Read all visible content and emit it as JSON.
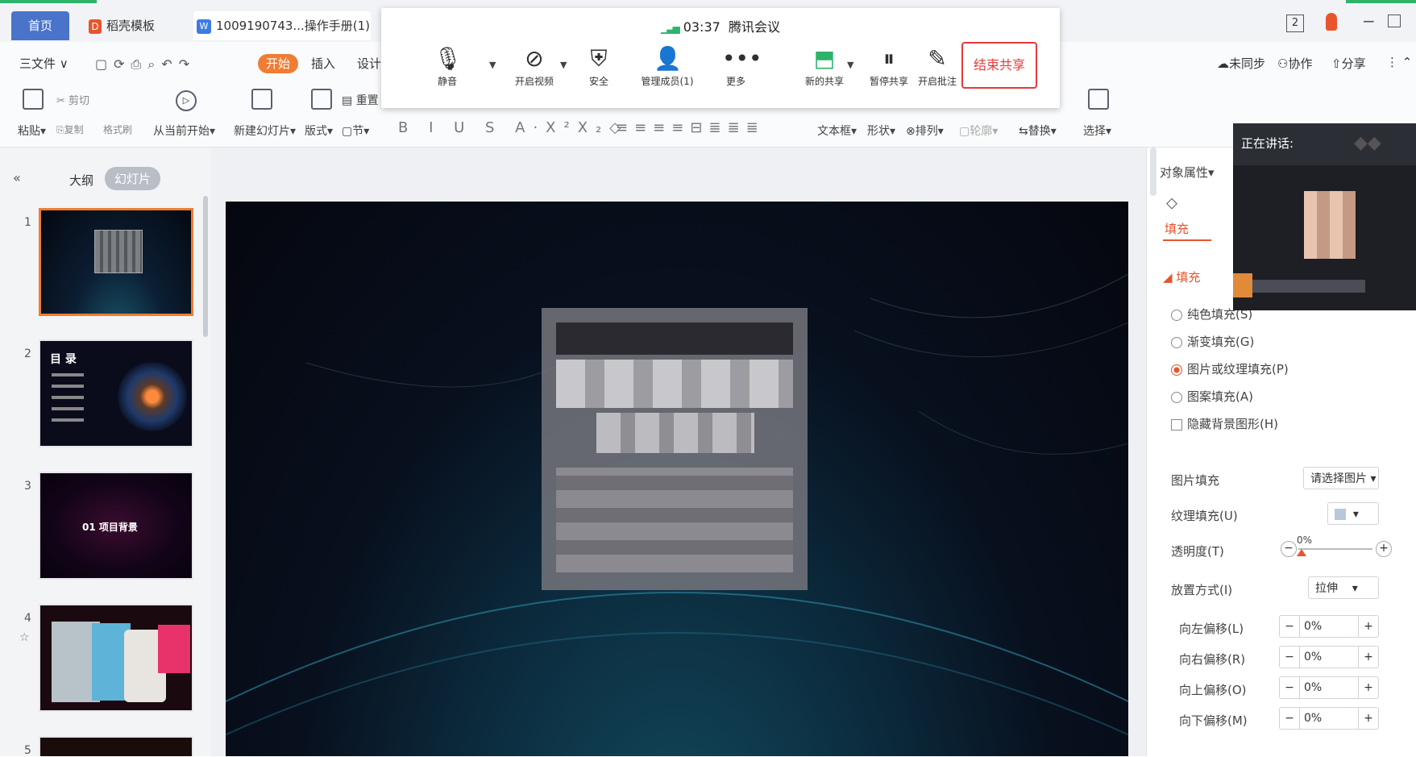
{
  "tabs": {
    "home": "首页",
    "daoke": "稻壳模板",
    "doc": "1009190743...操作手册(1)(1)"
  },
  "topright": {
    "badge": "2"
  },
  "menu": {
    "file": "三文件",
    "start": "开始",
    "insert": "插入",
    "design": "设计"
  },
  "ribbon": {
    "paste": "粘贴",
    "cut": "剪切",
    "copy": "复制",
    "format_painter": "格式刷",
    "from_start": "从当前开始",
    "new_slide": "新建幻灯片",
    "layout": "版式",
    "section": "节",
    "reset": "重置",
    "textbox": "文本框",
    "shape": "形状",
    "arrange": "排列",
    "outline": "轮廓",
    "replace": "替换",
    "select": "选择",
    "unsynced": "未同步",
    "collab": "协作",
    "share": "分享"
  },
  "meeting": {
    "time": "03:37",
    "name": "腾讯会议",
    "mute": "静音",
    "video": "开启视频",
    "security": "安全",
    "members": "管理成员(1)",
    "more": "更多",
    "new_share": "新的共享",
    "pause_share": "暂停共享",
    "annotate": "开启批注",
    "end_share": "结束共享"
  },
  "leftpanel": {
    "outline": "大纲",
    "slides": "幻灯片",
    "slide_numbers": [
      "1",
      "2",
      "3",
      "4",
      "5"
    ],
    "slide2_title": "目 录",
    "slide3_title": "01 项目背景"
  },
  "speaker": {
    "label": "正在讲话:"
  },
  "props": {
    "title": "对象属性",
    "fill_tab": "填充",
    "fill_section": "填充",
    "solid": "纯色填充(S)",
    "gradient": "渐变填充(G)",
    "picture": "图片或纹理填充(P)",
    "pattern": "图案填充(A)",
    "hide_bg": "隐藏背景图形(H)",
    "picture_fill": "图片填充",
    "picture_fill_value": "请选择图片",
    "texture_fill": "纹理填充(U)",
    "transparency": "透明度(T)",
    "transparency_value": "0%",
    "placement": "放置方式(I)",
    "placement_value": "拉伸",
    "offset_left": "向左偏移(L)",
    "offset_right": "向右偏移(R)",
    "offset_up": "向上偏移(O)",
    "offset_down": "向下偏移(M)",
    "offset_value": "0%"
  }
}
